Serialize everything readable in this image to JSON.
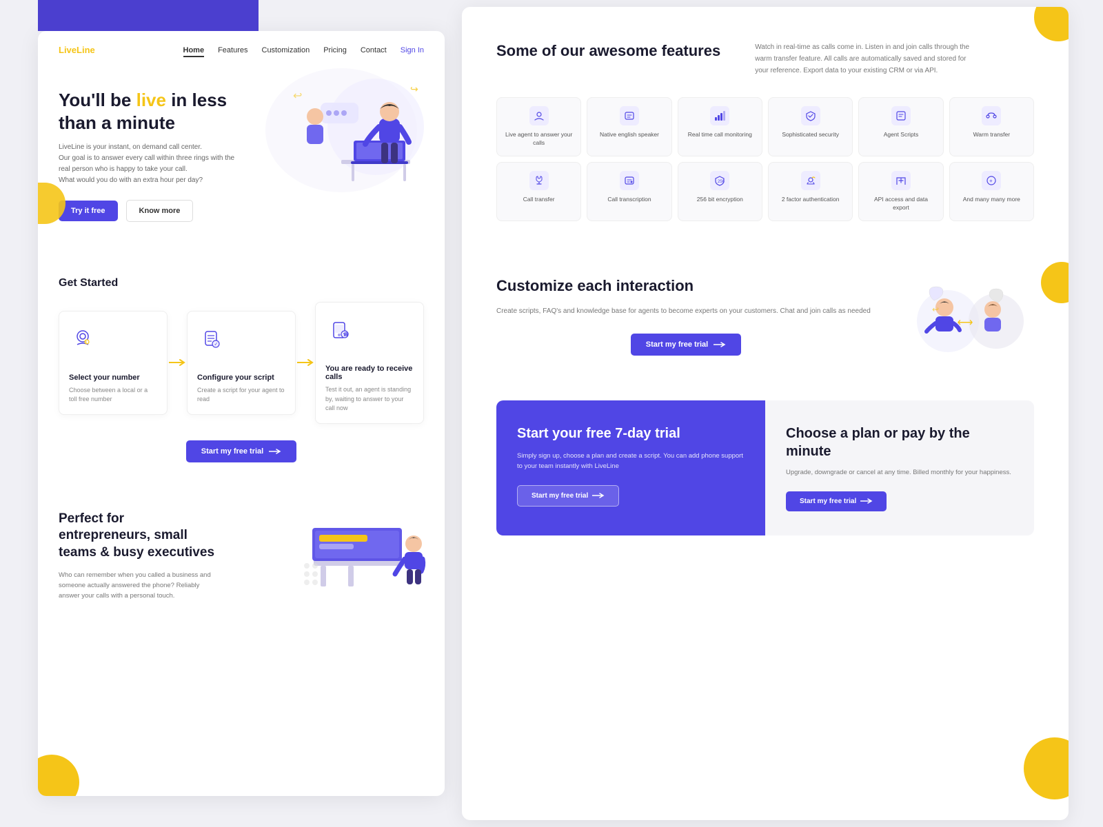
{
  "brand": {
    "name": "LiveLine",
    "color": "#f5c518"
  },
  "nav": {
    "links": [
      {
        "label": "Home",
        "active": true
      },
      {
        "label": "Features",
        "active": false
      },
      {
        "label": "Customization",
        "active": false
      },
      {
        "label": "Pricing",
        "active": false
      },
      {
        "label": "Contact",
        "active": false
      },
      {
        "label": "Sign In",
        "active": false,
        "special": true
      }
    ]
  },
  "hero": {
    "title_pre": "You'll be ",
    "title_highlight": "live",
    "title_post": " in less than a minute",
    "description": "LiveLine is your instant, on demand call center.\nOur goal is to answer every call within three rings with the\nreal person who is happy to take your call.\nWhat would you do with an extra hour per day?",
    "btn_try": "Try it free",
    "btn_know": "Know more"
  },
  "get_started": {
    "title": "Get Started",
    "steps": [
      {
        "title": "Select your number",
        "description": "Choose between a local or a toll free number"
      },
      {
        "title": "Configure your script",
        "description": "Create a script for your agent to read"
      },
      {
        "title": "You are ready to receive calls",
        "description": "Test it out, an agent is standing by, waiting to answer to your call now"
      }
    ],
    "btn_label": "Start my free trial",
    "btn_arrow": "→"
  },
  "perfect_for": {
    "title": "Perfect for entrepreneurs, small teams & busy executives",
    "description": "Who can remember when you called a business and someone actually answered the phone? Reliably answer your calls with a personal touch."
  },
  "features": {
    "title": "Some of our awesome features",
    "description": "Watch in real-time as calls come in. Listen in and join calls through the warm transfer feature. All calls are automatically saved and stored for your reference. Export data to your existing CRM or via API.",
    "items": [
      {
        "label": "Live agent to answer your calls"
      },
      {
        "label": "Native english speaker"
      },
      {
        "label": "Real time call monitoring"
      },
      {
        "label": "Sophisticated security"
      },
      {
        "label": "Agent Scripts"
      },
      {
        "label": "Warm transfer"
      },
      {
        "label": "Call transfer"
      },
      {
        "label": "Call transcription"
      },
      {
        "label": "256 bit encryption"
      },
      {
        "label": "2 factor authentication"
      },
      {
        "label": "API access and data export"
      },
      {
        "label": "And many many more"
      }
    ]
  },
  "customize": {
    "title": "Customize each interaction",
    "description": "Create scripts, FAQ's and knowledge base for agents to become experts on your customers. Chat and join calls as needed",
    "btn_label": "Start my free trial",
    "btn_arrow": "→"
  },
  "cta_left": {
    "title": "Start your free 7-day trial",
    "description": "Simply sign up, choose a plan and create a script. You can add phone support to your team instantly with LiveLine",
    "btn_label": "Start my free trial",
    "btn_arrow": "→"
  },
  "cta_right": {
    "title": "Choose a plan or pay by the minute",
    "description": "Upgrade, downgrade or cancel at any time. Billed monthly for your happiness.",
    "btn_label": "Start my free trial",
    "btn_arrow": "→"
  }
}
